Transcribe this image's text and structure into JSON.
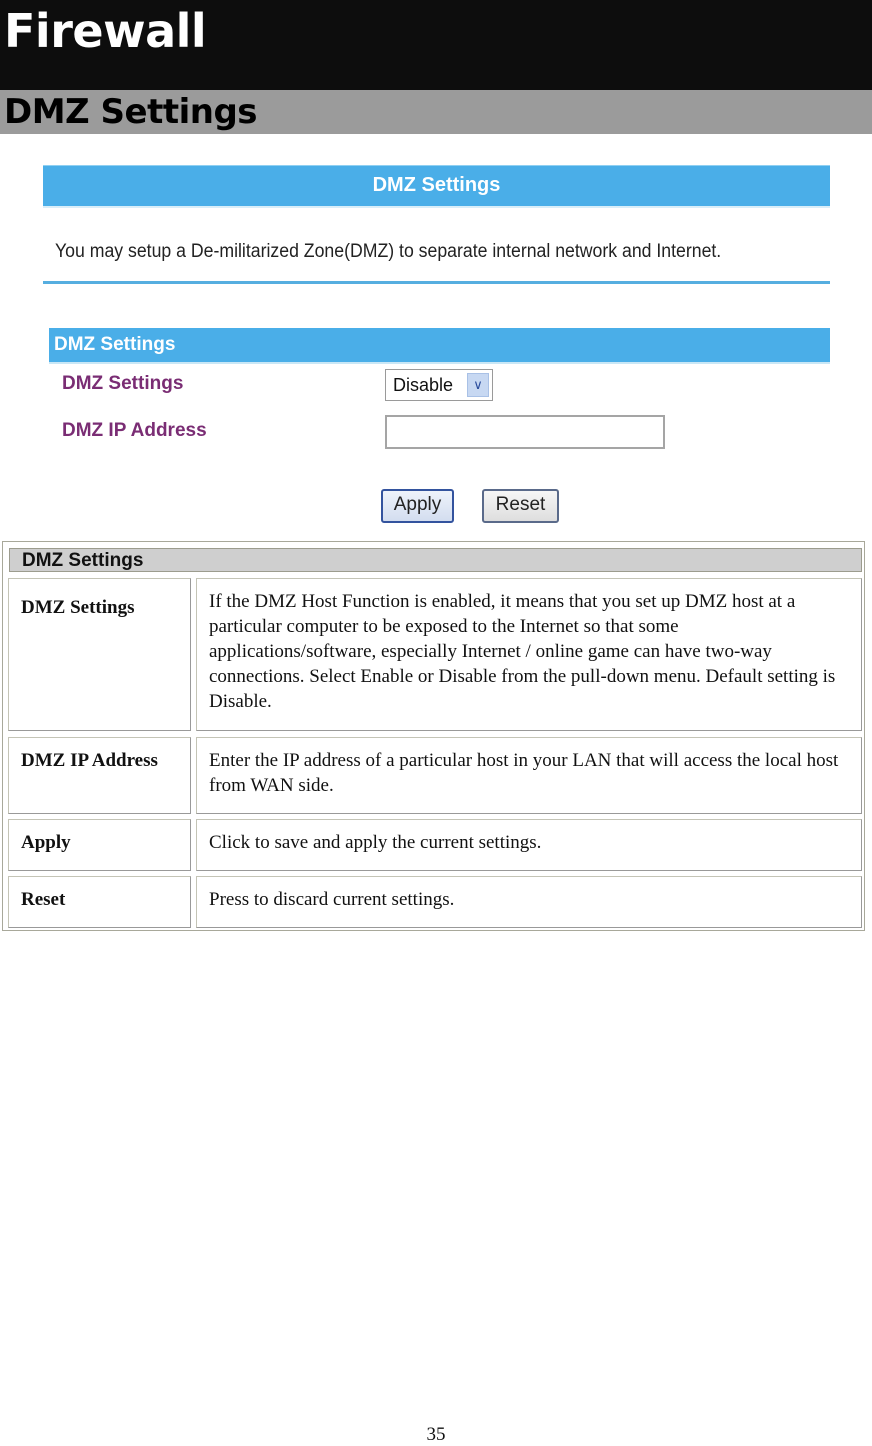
{
  "chapter_title": "Firewall",
  "section_title": "DMZ Settings",
  "router_ui": {
    "header_title": "DMZ Settings",
    "intro_text": "You may setup a De-militarized Zone(DMZ) to separate internal network and Internet.",
    "section_header": "DMZ Settings",
    "fields": {
      "dmz_settings_label": "DMZ Settings",
      "dmz_settings_value": "Disable",
      "dmz_ip_label": "DMZ IP Address",
      "dmz_ip_value": ""
    },
    "buttons": {
      "apply": "Apply",
      "reset": "Reset"
    },
    "colors": {
      "header_bar": "#4aaee8",
      "label_text": "#7a2d74"
    }
  },
  "description_table": {
    "header": "DMZ Settings",
    "rows": [
      {
        "term": "DMZ Settings",
        "description": "If the DMZ Host Function is enabled, it means that you set up DMZ host at a particular computer to be exposed to the Internet so that some applications/software, especially Internet / online game can have two-way connections. Select Enable or Disable from the pull-down menu. Default setting is Disable."
      },
      {
        "term": "DMZ IP Address",
        "description": "Enter the IP address of a particular host in your LAN that will access the local host from WAN side."
      },
      {
        "term": "Apply",
        "description": "Click to save and apply the current settings."
      },
      {
        "term": "Reset",
        "description": "Press to discard current settings."
      }
    ]
  },
  "page_number": "35"
}
